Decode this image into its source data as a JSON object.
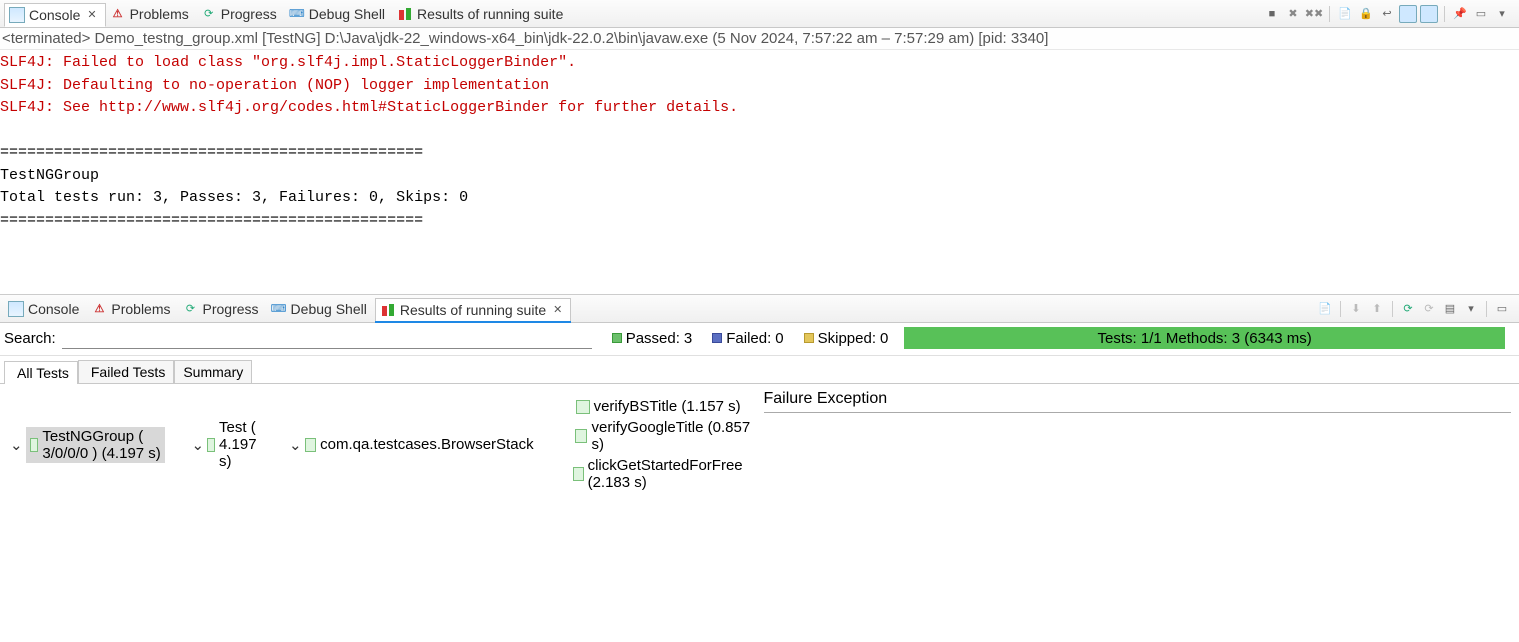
{
  "top": {
    "tabs": {
      "console": "Console",
      "problems": "Problems",
      "progress": "Progress",
      "debug": "Debug Shell",
      "results": "Results of running suite"
    },
    "terminated": "<terminated> Demo_testng_group.xml [TestNG] D:\\Java\\jdk-22_windows-x64_bin\\jdk-22.0.2\\bin\\javaw.exe  (5 Nov 2024, 7:57:22 am – 7:57:29 am) [pid: 3340]",
    "console_err": [
      "SLF4J: Failed to load class \"org.slf4j.impl.StaticLoggerBinder\".",
      "SLF4J: Defaulting to no-operation (NOP) logger implementation",
      "SLF4J: See http://www.slf4j.org/codes.html#StaticLoggerBinder for further details."
    ],
    "console_out": [
      "",
      "===============================================",
      "TestNGGroup",
      "Total tests run: 3, Passes: 3, Failures: 0, Skips: 0",
      "==============================================="
    ]
  },
  "bottom": {
    "tabs": {
      "console": "Console",
      "problems": "Problems",
      "progress": "Progress",
      "debug": "Debug Shell",
      "results": "Results of running suite"
    },
    "search_label": "Search:",
    "search_value": "",
    "passed_label": "Passed:",
    "passed_count": "3",
    "failed_label": "Failed:",
    "failed_count": "0",
    "skipped_label": "Skipped:",
    "skipped_count": "0",
    "progress_text": "Tests: 1/1  Methods: 3 (6343 ms)",
    "subtabs": {
      "all": "All Tests",
      "failed": "Failed Tests",
      "summary": "Summary"
    },
    "tree": {
      "root": "TestNGGroup ( 3/0/0/0 ) (4.197 s)",
      "test": "Test ( 4.197 s)",
      "cls": "com.qa.testcases.BrowserStack",
      "m1": "verifyBSTitle  (1.157 s)",
      "m2": "verifyGoogleTitle  (0.857 s)",
      "m3": "clickGetStartedForFree  (2.183 s)"
    },
    "failure_heading": "Failure Exception"
  }
}
